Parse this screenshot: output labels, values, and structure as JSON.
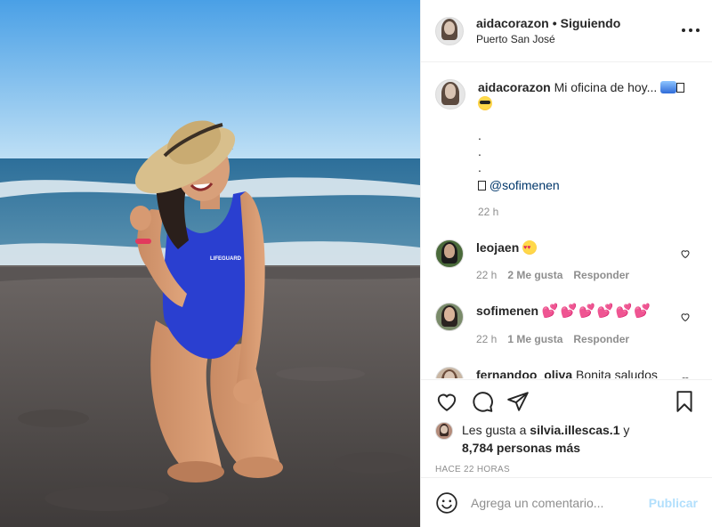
{
  "post": {
    "image_alt": "",
    "swimsuit_text": "LIFEGUARD"
  },
  "header": {
    "username": "aidacorazon",
    "separator": "•",
    "follow_status": "Siguiendo",
    "location": "Puerto San José"
  },
  "caption": {
    "username": "aidacorazon",
    "text": "Mi oficina de hoy...",
    "dots": [
      ".",
      ".",
      "."
    ],
    "mention": "@sofimenen",
    "time": "22 h"
  },
  "comments": [
    {
      "username": "leojaen",
      "text": "",
      "time": "22 h",
      "likes": "2 Me gusta",
      "reply": "Responder"
    },
    {
      "username": "sofimenen",
      "text": "💕💕💕💕💕💕",
      "time": "22 h",
      "likes": "1 Me gusta",
      "reply": "Responder"
    },
    {
      "username": "fernandoo_oliva",
      "text": "Bonita saludos"
    }
  ],
  "likes": {
    "prefix": "Les gusta a",
    "user": "silvia.illescas.1",
    "conj": "y",
    "others": "8,784 personas más"
  },
  "timestamp": "HACE 22 HORAS",
  "add_comment": {
    "placeholder": "Agrega un comentario...",
    "publish_label": "Publicar"
  },
  "icons": [
    "heart-icon",
    "comment-icon",
    "share-icon",
    "bookmark-icon",
    "more-icon",
    "emoji-icon"
  ],
  "colors": {
    "link": "#00376b",
    "publish_disabled": "#b2dffc",
    "muted": "#8e8e8e"
  }
}
